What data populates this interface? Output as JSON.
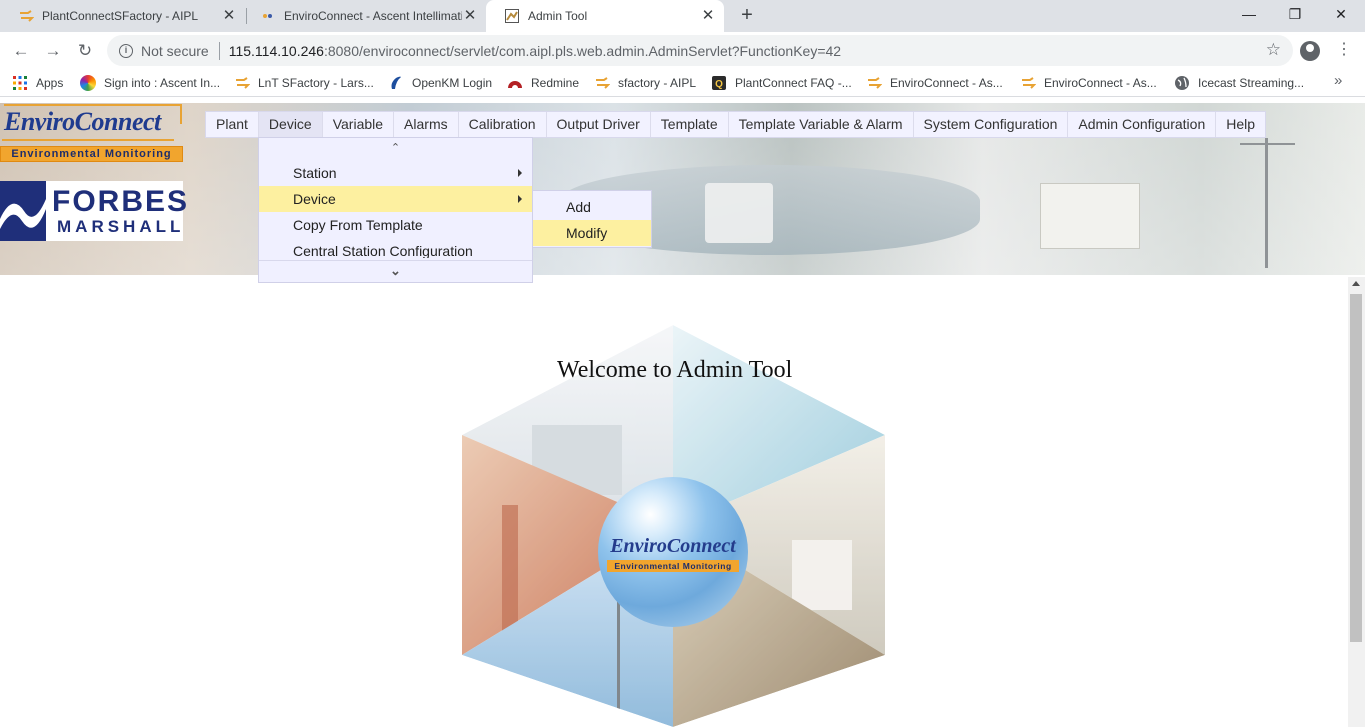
{
  "browser": {
    "tabs": [
      {
        "title": "PlantConnectSFactory - AIPL",
        "active": false
      },
      {
        "title": "EnviroConnect - Ascent Intellimati",
        "active": false
      },
      {
        "title": "Admin Tool",
        "active": true
      }
    ],
    "window_controls": {
      "minimize": "—",
      "restore": "❐",
      "close": "✕"
    },
    "address": {
      "security_label": "Not secure",
      "host": "115.114.10.246",
      "path": ":8080/enviroconnect/servlet/com.aipl.pls.web.admin.AdminServlet?FunctionKey=42"
    },
    "bookmarks": [
      {
        "label": "Apps",
        "icon": "apps-grid-icon"
      },
      {
        "label": "Sign into : Ascent In...",
        "icon": "color-wheel-icon"
      },
      {
        "label": "LnT SFactory - Lars...",
        "icon": "sfactory-icon"
      },
      {
        "label": "OpenKM Login",
        "icon": "openkm-icon"
      },
      {
        "label": "Redmine",
        "icon": "redmine-icon"
      },
      {
        "label": "sfactory - AIPL",
        "icon": "sfactory-icon"
      },
      {
        "label": "PlantConnect FAQ -...",
        "icon": "faq-icon"
      },
      {
        "label": "EnviroConnect - As...",
        "icon": "sfactory-icon"
      },
      {
        "label": "EnviroConnect - As...",
        "icon": "sfactory-icon"
      },
      {
        "label": "Icecast Streaming...",
        "icon": "globe-icon"
      }
    ],
    "bookmarks_overflow": "»"
  },
  "app": {
    "logo": {
      "name": "EnviroConnect",
      "tagline": "Environmental Monitoring"
    },
    "partner_logo": {
      "line1": "FORBES",
      "line2": "MARSHALL"
    },
    "menu": [
      {
        "label": "Plant",
        "open": false
      },
      {
        "label": "Device",
        "open": true
      },
      {
        "label": "Variable",
        "open": false
      },
      {
        "label": "Alarms",
        "open": false
      },
      {
        "label": "Calibration",
        "open": false
      },
      {
        "label": "Output Driver",
        "open": false
      },
      {
        "label": "Template",
        "open": false
      },
      {
        "label": "Template Variable & Alarm",
        "open": false
      },
      {
        "label": "System Configuration",
        "open": false
      },
      {
        "label": "Admin Configuration",
        "open": false
      },
      {
        "label": "Help",
        "open": false
      }
    ],
    "device_menu": {
      "scroll_up": "⌃",
      "scroll_down": "⌄",
      "items": [
        {
          "label": "Station",
          "has_submenu": true,
          "highlighted": false
        },
        {
          "label": "Device",
          "has_submenu": true,
          "highlighted": true
        },
        {
          "label": "Copy From Template",
          "has_submenu": false,
          "highlighted": false
        },
        {
          "label": "Central Station Configuration",
          "has_submenu": false,
          "highlighted": false
        }
      ]
    },
    "device_submenu": {
      "items": [
        {
          "label": "Add",
          "highlighted": false
        },
        {
          "label": "Modify",
          "highlighted": true
        }
      ]
    },
    "welcome_text": "Welcome to Admin Tool",
    "colors": {
      "menu_bg": "#f2f2ff",
      "highlight": "#fdf0a0",
      "logo_blue": "#1f3b8f",
      "logo_orange": "#f1a52e"
    }
  }
}
